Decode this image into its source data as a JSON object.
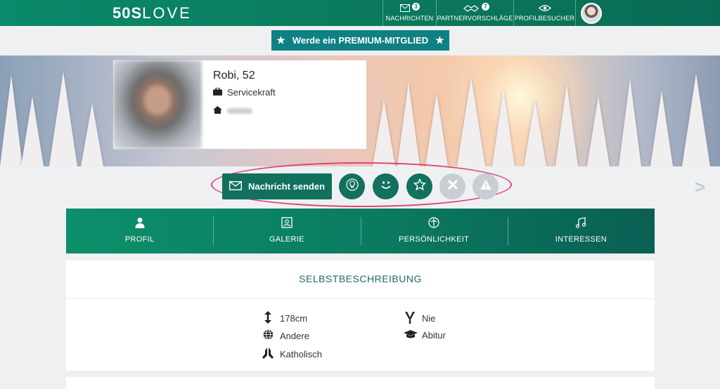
{
  "header": {
    "logo_bold": "50S",
    "logo_light": "LOVE",
    "nav": [
      {
        "label": "NACHRICHTEN",
        "badge": "3",
        "icon": "envelope-icon"
      },
      {
        "label": "PARTNERVORSCHLÄGE",
        "badge": "7",
        "icon": "handshake-icon"
      },
      {
        "label": "PROFILBESUCHER",
        "badge": "",
        "icon": "eye-icon"
      }
    ]
  },
  "premium": {
    "label": "Werde ein PREMIUM-MITGLIED"
  },
  "profile": {
    "name_age": "Robi, 52",
    "job": "Servicekraft"
  },
  "actions": {
    "send_message": "Nachricht senden",
    "next_arrow": ">"
  },
  "tabs": [
    {
      "label": "PROFIL",
      "icon": "person-icon"
    },
    {
      "label": "GALERIE",
      "icon": "gallery-icon"
    },
    {
      "label": "PERSÖNLICHKEIT",
      "icon": "personality-icon"
    },
    {
      "label": "INTERESSEN",
      "icon": "music-icon"
    }
  ],
  "self_description": {
    "title": "SELBSTBESCHREIBUNG",
    "height": "178cm",
    "ethnicity": "Andere",
    "religion": "Katholisch",
    "smoking": "Nie",
    "education": "Abitur"
  },
  "colors": {
    "brand_green": "#0b7a5e",
    "premium_teal": "#0f8084",
    "highlight_ellipse": "#d9457a"
  }
}
